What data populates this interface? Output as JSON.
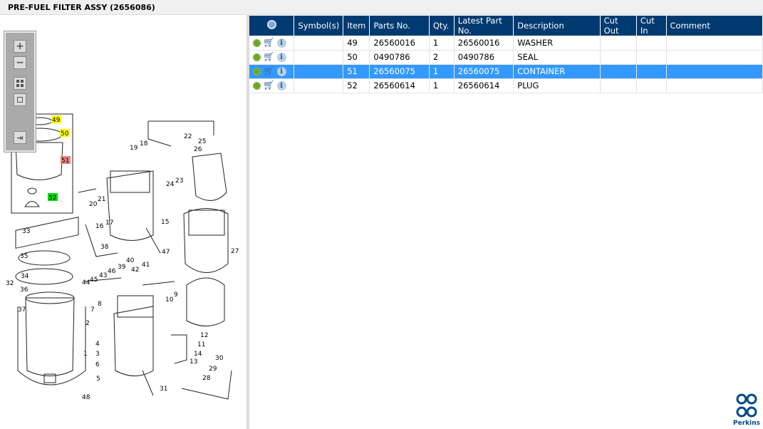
{
  "header": {
    "title": "PRE-FUEL FILTER ASSY (2656086)"
  },
  "zoom_toolbar": {
    "zoom_in": "+",
    "zoom_out": "−"
  },
  "table": {
    "columns": [
      "",
      "Symbol(s)",
      "Item",
      "Parts No.",
      "Qty.",
      "Latest Part No.",
      "Description",
      "Cut Out",
      "Cut In",
      "Comment"
    ],
    "rows": [
      {
        "item": "49",
        "part_no": "26560016",
        "qty": "1",
        "latest": "26560016",
        "desc": "WASHER",
        "symbol": "",
        "cut_out": "",
        "cut_in": "",
        "comment": "",
        "selected": false
      },
      {
        "item": "50",
        "part_no": "0490786",
        "qty": "2",
        "latest": "0490786",
        "desc": "SEAL",
        "symbol": "",
        "cut_out": "",
        "cut_in": "",
        "comment": "",
        "selected": false
      },
      {
        "item": "51",
        "part_no": "26560075",
        "qty": "1",
        "latest": "26560075",
        "desc": "CONTAINER",
        "symbol": "",
        "cut_out": "",
        "cut_in": "",
        "comment": "",
        "selected": true
      },
      {
        "item": "52",
        "part_no": "26560614",
        "qty": "1",
        "latest": "26560614",
        "desc": "PLUG",
        "symbol": "",
        "cut_out": "",
        "cut_in": "",
        "comment": "",
        "selected": false
      }
    ]
  },
  "diagram": {
    "inset_callouts": [
      {
        "label": "49",
        "color": "#ffff00"
      },
      {
        "label": "50",
        "color": "#ffff00"
      },
      {
        "label": "51",
        "color": "#f08080"
      },
      {
        "label": "52",
        "color": "#00dd00"
      }
    ],
    "callouts": [
      "33",
      "35",
      "34",
      "32",
      "36",
      "37",
      "48",
      "18",
      "19",
      "22",
      "25",
      "26",
      "24",
      "23",
      "20",
      "21",
      "16",
      "17",
      "15",
      "27",
      "38",
      "40",
      "39",
      "47",
      "41",
      "42",
      "45",
      "43",
      "46",
      "44",
      "7",
      "8",
      "2",
      "4",
      "3",
      "6",
      "1",
      "5",
      "9",
      "10",
      "12",
      "11",
      "14",
      "13",
      "30",
      "29",
      "28",
      "31"
    ]
  },
  "logo": {
    "text": "Perkins"
  },
  "colors": {
    "header_bg": "#003a70",
    "selected_row": "#3399ff"
  }
}
